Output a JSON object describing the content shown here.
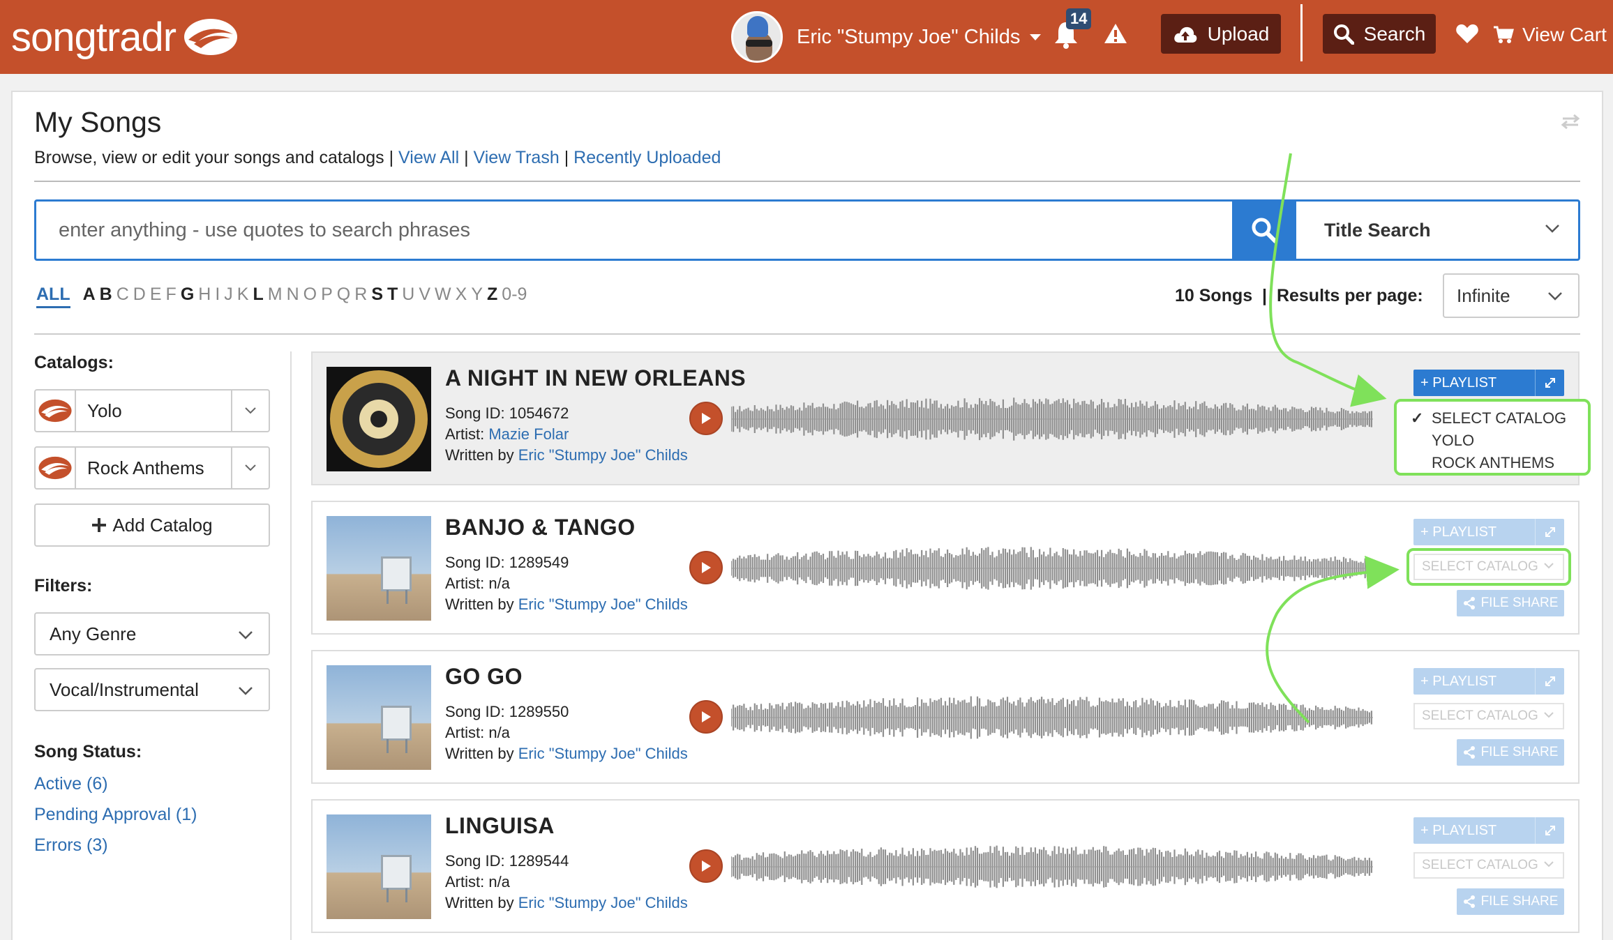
{
  "header": {
    "logo_text": "songtradr",
    "user_name": "Eric \"Stumpy Joe\" Childs",
    "notification_count": "14",
    "upload_label": "Upload",
    "search_label": "Search",
    "cart_label": "View Cart",
    "brand_color": "#c4502b"
  },
  "page": {
    "title": "My Songs",
    "subtitle": "Browse, view or edit your songs and catalogs",
    "links": [
      "View All",
      "View Trash",
      "Recently Uploaded"
    ]
  },
  "search": {
    "placeholder": "enter anything - use quotes to search phrases",
    "mode": "Title Search"
  },
  "alphabet": {
    "all": "ALL",
    "letters": [
      "A",
      "B",
      "C",
      "D",
      "E",
      "F",
      "G",
      "H",
      "I",
      "J",
      "K",
      "L",
      "M",
      "N",
      "O",
      "P",
      "Q",
      "R",
      "S",
      "T",
      "U",
      "V",
      "W",
      "X",
      "Y",
      "Z",
      "0-9"
    ],
    "active": [
      "A",
      "B",
      "G",
      "L",
      "S",
      "T",
      "Z"
    ]
  },
  "results": {
    "count_label": "10 Songs",
    "per_page_label": "Results per page:",
    "per_page_value": "Infinite"
  },
  "sidebar": {
    "catalogs_heading": "Catalogs:",
    "catalogs": [
      "Yolo",
      "Rock Anthems"
    ],
    "add_catalog": "Add Catalog",
    "filters_heading": "Filters:",
    "filters": [
      "Any Genre",
      "Vocal/Instrumental"
    ],
    "status_heading": "Song Status:",
    "statuses": [
      "Active (6)",
      "Pending Approval (1)",
      "Errors (3)"
    ]
  },
  "songs": [
    {
      "title": "A NIGHT IN NEW ORLEANS",
      "id_label": "Song ID: 1054672",
      "artist_label": "Artist:",
      "artist": "Mazie Folar",
      "written_label": "Written by",
      "writer": "Eric \"Stumpy Joe\" Childs"
    },
    {
      "title": "BANJO & TANGO",
      "id_label": "Song ID: 1289549",
      "artist_label": "Artist: n/a",
      "artist": "",
      "written_label": "Written by",
      "writer": "Eric \"Stumpy Joe\" Childs"
    },
    {
      "title": "GO GO",
      "id_label": "Song ID: 1289550",
      "artist_label": "Artist: n/a",
      "artist": "",
      "written_label": "Written by",
      "writer": "Eric \"Stumpy Joe\" Childs"
    },
    {
      "title": "LINGUISA",
      "id_label": "Song ID: 1289544",
      "artist_label": "Artist: n/a",
      "artist": "",
      "written_label": "Written by",
      "writer": "Eric \"Stumpy Joe\" Childs"
    }
  ],
  "actions": {
    "playlist": "PLAYLIST",
    "select_catalog": "SELECT CATALOG",
    "file_share": "FILE SHARE"
  },
  "catalog_dropdown": {
    "options": [
      "SELECT CATALOG",
      "YOLO",
      "ROCK ANTHEMS"
    ],
    "selected": "SELECT CATALOG"
  }
}
